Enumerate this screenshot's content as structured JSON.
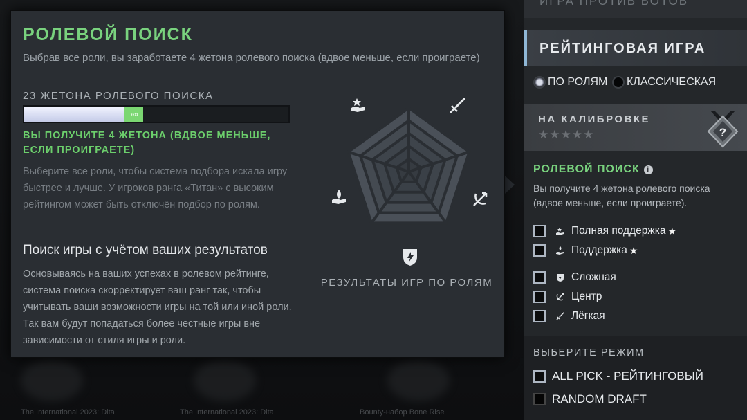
{
  "background": {
    "captions": [
      "The International 2023: Dita",
      "The International 2023: Dita",
      "Bounty-набор Bone Rise"
    ]
  },
  "tooltip": {
    "title": "РОЛЕВОЙ ПОИСК",
    "subtitle": "Выбрав все роли, вы заработаете 4 жетона ролевого поиска (вдвое меньше, если проиграете)",
    "tokens_title": "23 ЖЕТОНА РОЛЕВОГО ПОИСКА",
    "tokens_progress": 0.38,
    "tokens_gain_progress": 0.07,
    "gain_arrows": "»»",
    "gain_text": "ВЫ ПОЛУЧИТЕ 4 ЖЕТОНА (ВДВОЕ МЕНЬШЕ, ЕСЛИ ПРОИГРАЕТЕ)",
    "desc": "Выберите все роли, чтобы система подбора искала игру быстрее и лучше. У игроков ранга «Титан» с высоким рейтингом может быть отключён подбор по ролям.",
    "heading": "Поиск игры с учётом ваших результатов",
    "desc2": "Основываясь на ваших успехах в ролевом рейтинге, система поиска скорректирует ваш ранг так, чтобы учитывать ваши возможности игры на той или иной роли. Так вам будут попадаться более честные игры вне зависимости от стиля игры и роли.",
    "radar_caption": "РЕЗУЛЬТАТЫ ИГР ПО РОЛЯМ",
    "radar_icons": [
      "hard-support-icon",
      "carry-icon",
      "mid-icon",
      "offlane-icon",
      "support-icon"
    ]
  },
  "panel": {
    "top_label": "ИГРА ПРОТИВ БОТОВ",
    "header": "РЕЙТИНГОВАЯ ИГРА",
    "radio_roles": "ПО РОЛЯМ",
    "radio_classic": "КЛАССИЧЕСКАЯ",
    "selected_radio": "roles",
    "calibration_title": "НА КАЛИБРОВКЕ",
    "calibration_stars": "★★★★★",
    "medal_symbol": "?",
    "role_search_title": "РОЛЕВОЙ ПОИСК",
    "info_symbol": "i",
    "role_search_desc": "Вы получите 4 жетона ролевого поиска (вдвое меньше, если проиграете).",
    "roles": [
      {
        "label": "Полная поддержка",
        "star": "★",
        "icon": "hard-support-icon"
      },
      {
        "label": "Поддержка",
        "star": "★",
        "icon": "support-icon"
      },
      {
        "label": "Сложная",
        "star": "",
        "icon": "offlane-icon"
      },
      {
        "label": "Центр",
        "star": "",
        "icon": "mid-icon"
      },
      {
        "label": "Лёгкая",
        "star": "",
        "icon": "carry-icon"
      }
    ],
    "mode_title": "ВЫБЕРИТЕ РЕЖИМ",
    "modes": [
      {
        "label": "ALL PICK - РЕЙТИНГОВЫЙ",
        "checked": true
      },
      {
        "label": "RANDOM DRAFT",
        "checked": false
      }
    ]
  },
  "colors": {
    "accent_green": "#79d27e",
    "panel_bg": "#24272a",
    "tooltip_bg": "#2a2e33"
  }
}
